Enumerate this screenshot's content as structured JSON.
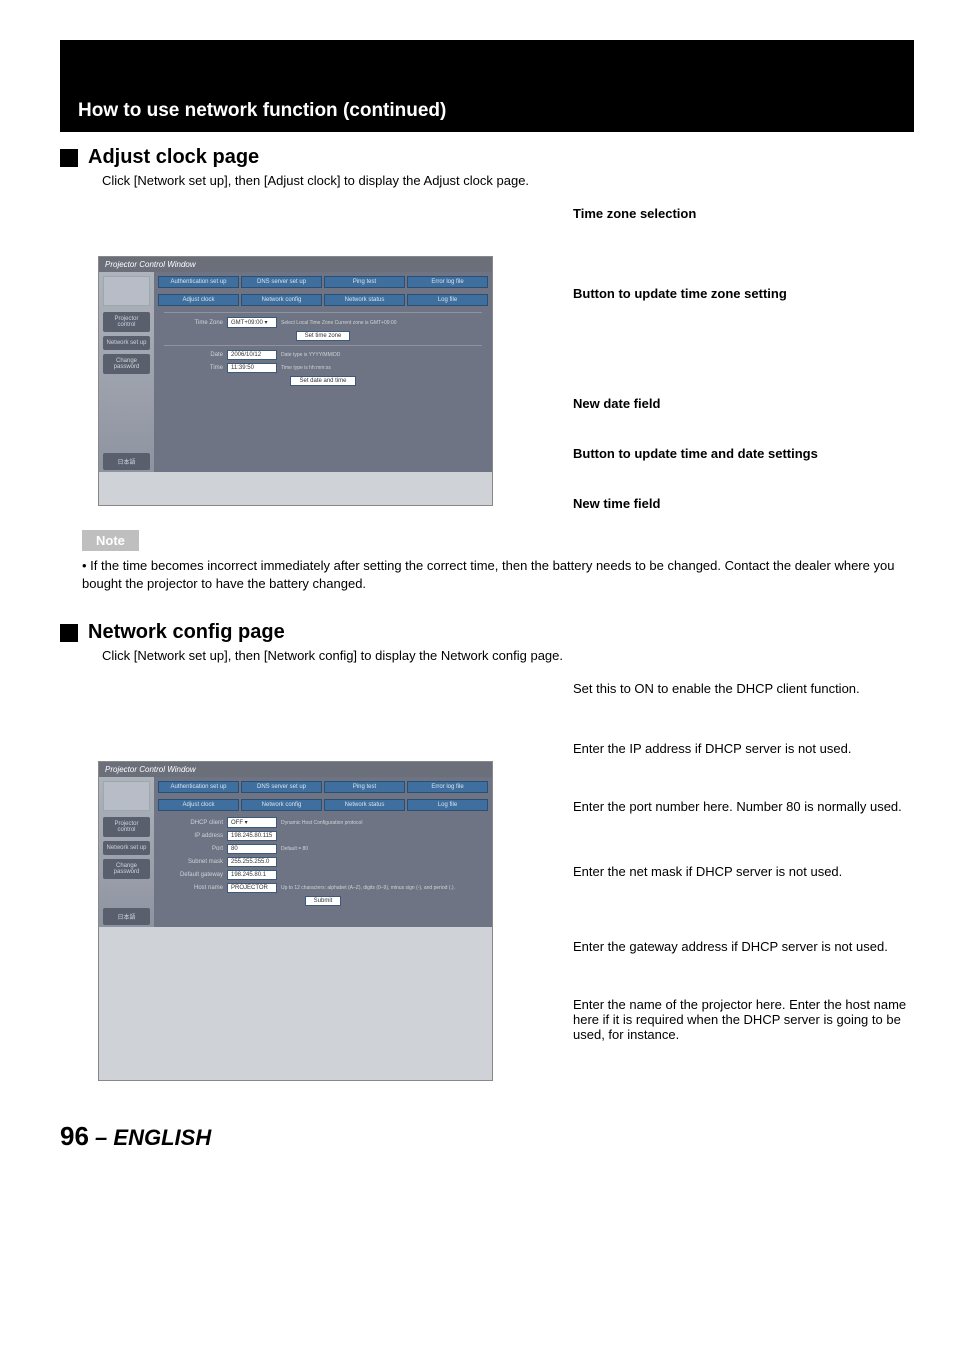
{
  "header": {
    "title": "How to use network function (continued)"
  },
  "section1": {
    "title": "Adjust clock page",
    "desc": "Click [Network set up], then [Adjust clock] to display the Adjust clock page.",
    "callouts": {
      "c1": "Time zone selection",
      "c2": "Button to update time zone setting",
      "c3": "New date field",
      "c4": "Button to update time and date settings",
      "c5": "New time field"
    }
  },
  "note": {
    "label": "Note",
    "text": "If the time becomes incorrect immediately after setting the correct time, then the battery needs to be changed. Contact the dealer where you bought the projector to have the battery changed."
  },
  "section2": {
    "title": "Network config page",
    "desc": "Click [Network set up], then [Network config] to display the Network config page.",
    "callouts": {
      "c1": "Set this to ON to enable the DHCP client function.",
      "c2": "Enter the IP address if DHCP server is not used.",
      "c3": "Enter the port number here. Number 80 is normally used.",
      "c4": "Enter the net mask if DHCP server is not used.",
      "c5": "Enter the gateway address if DHCP server is not used.",
      "c6": "Enter the name of the projector here. Enter the host name here if it is required when the DHCP server is going to be used, for instance."
    }
  },
  "pcw": {
    "title": "Projector Control Window",
    "side": {
      "m1": "Projector control",
      "m2": "Network set up",
      "m3": "Change password",
      "m4": "日本語"
    },
    "tabs": {
      "t1": "Authentication set up",
      "t2": "DNS server set up",
      "t3": "Ping test",
      "t4": "Error log file",
      "t5": "Adjust clock",
      "t6": "Network config",
      "t7": "Network status",
      "t8": "Log file"
    },
    "clock": {
      "tz_lbl": "Time Zone",
      "tz_val": "GMT+09:00 ▾",
      "tz_hint": "Select Local Time Zone\nCurrent zone is GMT+09:00",
      "tz_btn": "Set time zone",
      "date_lbl": "Date",
      "date_val": "2006/10/12",
      "date_hint": "Date type is YYYY/MM/DD",
      "time_lbl": "Time",
      "time_val": "11:39:50",
      "time_hint": "Time type is hh:mm:ss",
      "dt_btn": "Set date and time"
    },
    "net": {
      "dhcp_lbl": "DHCP client",
      "dhcp_val": "OFF ▾",
      "dhcp_hint": "Dynamic Host Configuration protocol",
      "ip_lbl": "IP address",
      "ip_val": "198.245.80.115",
      "port_lbl": "Port",
      "port_val": "80",
      "port_hint": "Default = 80",
      "mask_lbl": "Subnet mask",
      "mask_val": "255.255.255.0",
      "gw_lbl": "Default gateway",
      "gw_val": "198.245.80.1",
      "host_lbl": "Host name",
      "host_val": "PROJECTOR",
      "host_hint": "Up to 12 characters: alphabet (A–Z), digits (0–9), minus sign (-), and period (.).",
      "submit": "Submit"
    }
  },
  "footer": {
    "num": "96",
    "dash": "–",
    "lang": "ENGLISH"
  }
}
